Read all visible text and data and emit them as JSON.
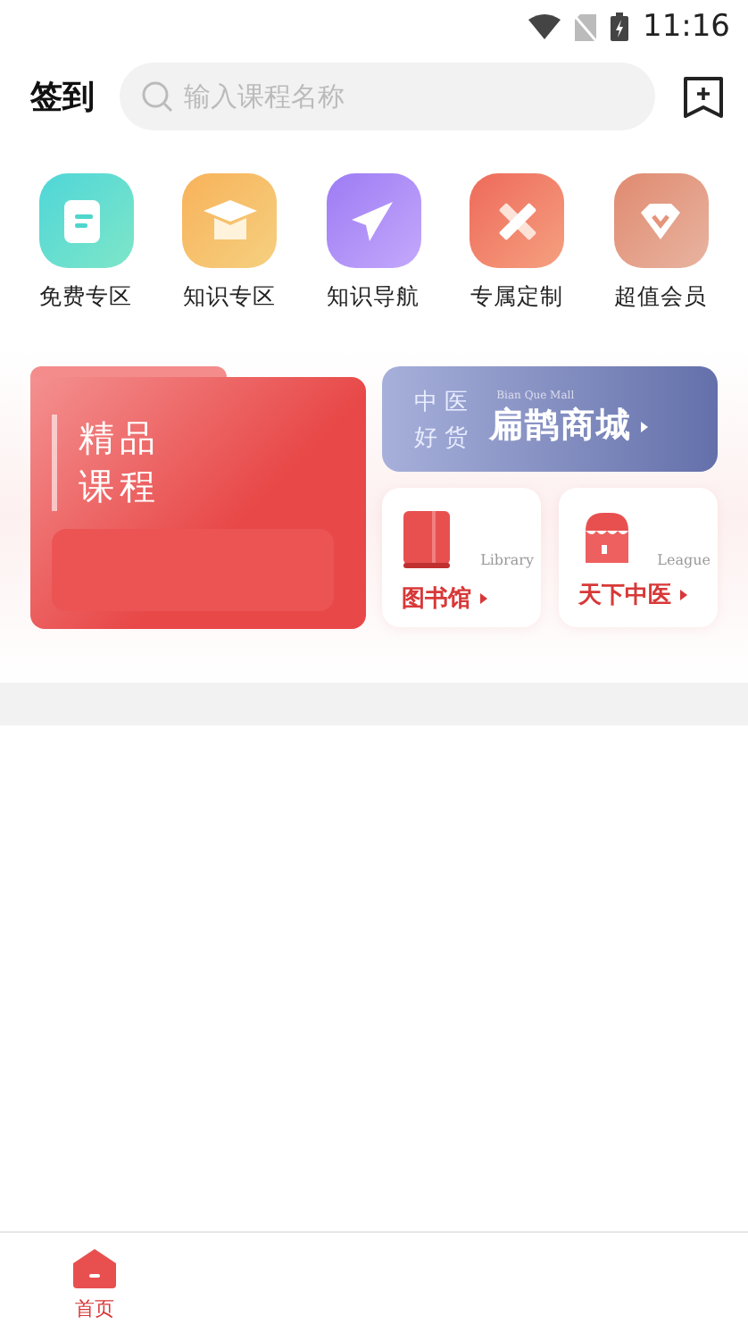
{
  "status_bar": {
    "time": "11:16"
  },
  "header": {
    "checkin": "签到",
    "search": {
      "placeholder": "输入课程名称"
    }
  },
  "shortcuts": [
    {
      "label": "免费专区",
      "kind": "doc"
    },
    {
      "label": "知识专区",
      "kind": "cap"
    },
    {
      "label": "知识导航",
      "kind": "plane"
    },
    {
      "label": "专属定制",
      "kind": "ruler"
    },
    {
      "label": "超值会员",
      "kind": "gem"
    }
  ],
  "featured": {
    "title_lines": [
      "精品",
      "课程"
    ]
  },
  "mall": {
    "tag_lines": [
      "中 医",
      "好 货"
    ],
    "caption": "Bian Que Mall",
    "title": "扁鹊商城"
  },
  "cards": [
    {
      "kind": "book",
      "caption": "Library",
      "title": "图书馆"
    },
    {
      "kind": "shop",
      "caption": "League",
      "title": "天下中医"
    }
  ],
  "tabs": [
    {
      "label": "首页",
      "selected": true
    }
  ]
}
